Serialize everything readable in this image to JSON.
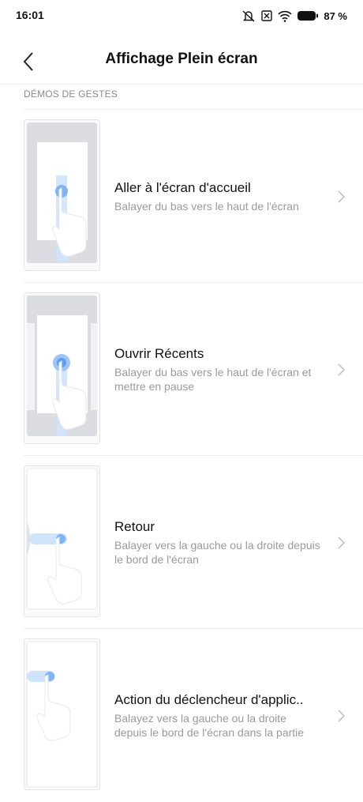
{
  "status_bar": {
    "time": "16:01",
    "battery": "87 %",
    "icons": [
      "alarm-off-icon",
      "sim-disabled-icon",
      "wifi-icon",
      "battery-icon"
    ]
  },
  "header": {
    "back_icon": "back-arrow-icon",
    "title": "Affichage Plein écran"
  },
  "section": {
    "title": "DÉMOS DE GESTES"
  },
  "gestures": [
    {
      "title": "Aller à l'écran d'accueil",
      "description": "Balayer du bas vers le haut de l'écran"
    },
    {
      "title": "Ouvrir Récents",
      "description": "Balayer du bas vers le haut de l'écran et mettre en pause"
    },
    {
      "title": "Retour",
      "description": "Balayer vers la gauche ou la droite depuis le bord de l'écran"
    },
    {
      "title": "Action du déclencheur d'applic..",
      "description": "Balayez vers la gauche ou la droite depuis le bord de l'écran dans la partie"
    }
  ],
  "colors": {
    "accent_blue": "#3d8bff",
    "secondary_text": "#9a9a9a",
    "divider": "#ececec"
  }
}
